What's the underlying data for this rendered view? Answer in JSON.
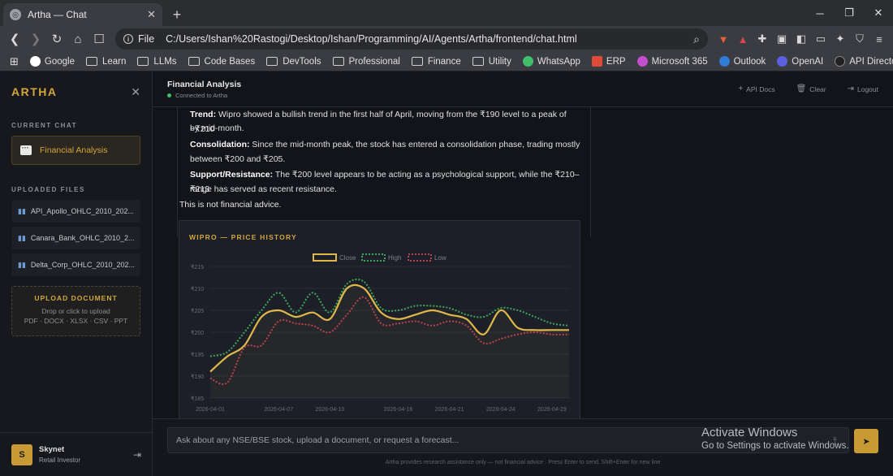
{
  "browser": {
    "tab_title": "Artha — Chat",
    "new_tab": "+",
    "file_label": "File",
    "url": "C:/Users/Ishan%20Rastogi/Desktop/Ishan/Programming/AI/Agents/Artha/frontend/chat.html",
    "bookmarks": [
      "Google",
      "Learn",
      "LLMs",
      "Code Bases",
      "DevTools",
      "Professional",
      "Finance",
      "Utility",
      "WhatsApp",
      "ERP",
      "Microsoft 365",
      "Outlook",
      "OpenAI",
      "API Directory"
    ]
  },
  "sidebar": {
    "brand": "ARTHA",
    "current_chat_label": "CURRENT CHAT",
    "current_chat": "Financial Analysis",
    "uploaded_files_label": "UPLOADED FILES",
    "files": [
      "API_Apollo_OHLC_2010_202...",
      "Canara_Bank_OHLC_2010_2...",
      "Delta_Corp_OHLC_2010_202..."
    ],
    "upload_title": "UPLOAD DOCUMENT",
    "upload_hint": "Drop or click to upload",
    "upload_types": "PDF · DOCX · XLSX · CSV · PPT",
    "user_initial": "S",
    "user_name": "Skynet",
    "user_role": "Retail Investor"
  },
  "header": {
    "title": "Financial Analysis",
    "status": "Connected to Artha",
    "api_docs": "API Docs",
    "clear": "Clear",
    "logout": "Logout"
  },
  "message": {
    "trend_label": "Trend:",
    "trend_line1": "Wipro showed a bullish trend in the first half of April, moving from the ₹190 level to a peak of ~₹210",
    "trend_line2": "by mid-month.",
    "consol_label": "Consolidation:",
    "consol_line1": "Since the mid-month peak, the stock has entered a consolidation phase, trading mostly",
    "consol_line2": "between ₹200 and ₹205.",
    "sr_label": "Support/Resistance:",
    "sr_line1": "The ₹200 level appears to be acting as a psychological support, while the ₹210–₹213",
    "sr_line2": "range has served as recent resistance.",
    "disclaimer": "This is not financial advice."
  },
  "chart_data": {
    "type": "line",
    "title": "WIPRO — PRICE HISTORY",
    "x": [
      "2026-04-01",
      "2026-04-02",
      "2026-04-03",
      "2026-04-06",
      "2026-04-07",
      "2026-04-08",
      "2026-04-09",
      "2026-04-10",
      "2026-04-13",
      "2026-04-14",
      "2026-04-15",
      "2026-04-16",
      "2026-04-17",
      "2026-04-20",
      "2026-04-21",
      "2026-04-22",
      "2026-04-23",
      "2026-04-24",
      "2026-04-27",
      "2026-04-28",
      "2026-04-29",
      "2026-04-30"
    ],
    "x_tick_labels": [
      "2026-04-01",
      "2026-04-07",
      "2026-04-10",
      "2026-04-16",
      "2026-04-21",
      "2026-04-24",
      "2026-04-29"
    ],
    "series": [
      {
        "name": "Close",
        "color": "#e0b84a",
        "values": [
          191,
          194.5,
          197,
          203.5,
          205,
          203.5,
          204.5,
          203,
          210,
          210,
          204.5,
          203,
          204,
          205,
          204,
          203,
          199.5,
          205,
          201,
          200.5,
          200.5,
          200.5
        ]
      },
      {
        "name": "High",
        "color": "#3fa65a",
        "values": [
          194.5,
          195.5,
          200,
          205,
          209,
          204.5,
          209,
          204.5,
          211,
          211.5,
          205.5,
          205,
          206,
          206,
          205.5,
          204,
          203.5,
          205.5,
          205,
          203.5,
          202,
          201.5
        ]
      },
      {
        "name": "Low",
        "color": "#b8434f",
        "values": [
          189.5,
          188.5,
          196.5,
          197,
          202.5,
          202,
          201.5,
          200,
          204,
          208,
          202,
          202,
          202.5,
          201.5,
          202.5,
          201.5,
          197.5,
          198.5,
          199.5,
          200,
          199.5,
          199.5
        ]
      }
    ],
    "ylim": [
      185,
      215
    ],
    "y_ticks": [
      "₹185",
      "₹190",
      "₹195",
      "₹200",
      "₹205",
      "₹210",
      "₹215"
    ],
    "legend_position": "top",
    "grid": true
  },
  "composer": {
    "placeholder": "Ask about any NSE/BSE stock, upload a document, or request a forecast...",
    "footnote": "Artha provides research assistance only — not financial advice · Press Enter to send, Shift+Enter for new line"
  },
  "watermark": {
    "line1": "Activate Windows",
    "line2": "Go to Settings to activate Windows."
  }
}
